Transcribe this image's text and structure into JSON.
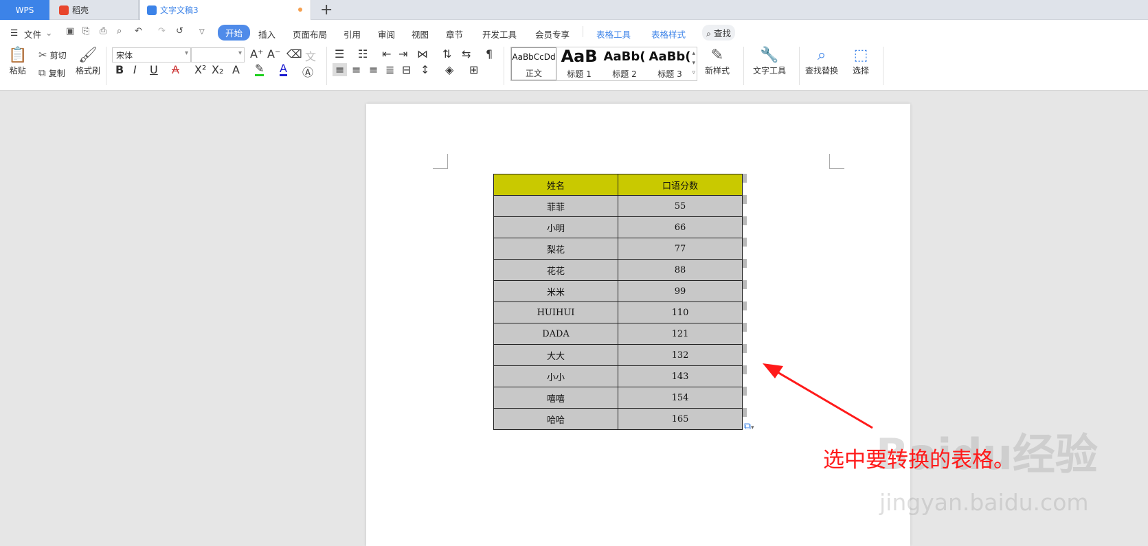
{
  "tabs": {
    "wps": "WPS",
    "daoke": "稻壳",
    "doc": "文字文稿3"
  },
  "menu": {
    "file": "文件",
    "items": [
      "开始",
      "插入",
      "页面布局",
      "引用",
      "审阅",
      "视图",
      "章节",
      "开发工具",
      "会员专享"
    ],
    "context": [
      "表格工具",
      "表格样式"
    ],
    "search": "查找"
  },
  "ribbon": {
    "paste": "粘贴",
    "cut": "剪切",
    "copy": "复制",
    "format_painter": "格式刷",
    "font_name": "宋体",
    "font_size": "",
    "styles": [
      {
        "preview": "AaBbCcDd",
        "label": "正文"
      },
      {
        "preview": "AaB",
        "label": "标题 1"
      },
      {
        "preview": "AaBb(",
        "label": "标题 2"
      },
      {
        "preview": "AaBb(",
        "label": "标题 3"
      }
    ],
    "new_style": "新样式",
    "text_tools": "文字工具",
    "find_replace": "查找替换",
    "select": "选择"
  },
  "table": {
    "headers": [
      "姓名",
      "口语分数"
    ],
    "rows": [
      [
        "菲菲",
        "55"
      ],
      [
        "小明",
        "66"
      ],
      [
        "梨花",
        "77"
      ],
      [
        "花花",
        "88"
      ],
      [
        "米米",
        "99"
      ],
      [
        "HUIHUI",
        "110"
      ],
      [
        "DADA",
        "121"
      ],
      [
        "大大",
        "132"
      ],
      [
        "小小",
        "143"
      ],
      [
        "嘻嘻",
        "154"
      ],
      [
        "哈哈",
        "165"
      ]
    ]
  },
  "annotation": "选中要转换的表格。",
  "watermark": {
    "brand": "Baidu经验",
    "url": "jingyan.baidu.com"
  },
  "colors": {
    "accent": "#3c83e8",
    "header_fill": "#c9c900",
    "cell_fill": "#c8c8c8",
    "annotation": "#ff1a1a"
  }
}
